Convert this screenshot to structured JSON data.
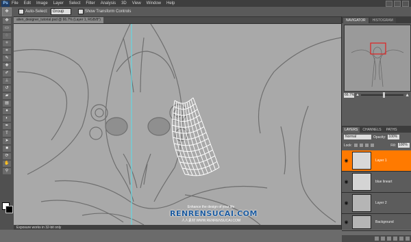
{
  "menubar": {
    "logo": "Ps",
    "items": [
      "File",
      "Edit",
      "Image",
      "Layer",
      "Select",
      "Filter",
      "Analysis",
      "3D",
      "View",
      "Window",
      "Help"
    ]
  },
  "options_bar": {
    "auto_select_label": "Auto-Select:",
    "auto_select_value": "Group",
    "transform_label": "Show Transform Controls"
  },
  "document_tab": {
    "title": "alien_designer_tutorial.psd @ 66.7% (Layer 1, RGB/8*)"
  },
  "status_bar": {
    "text": "Exposure works in 32-bit only"
  },
  "navigator": {
    "tabs": [
      "NAVIGATOR",
      "HISTOGRAM"
    ],
    "zoom": "66.7%"
  },
  "layers_panel": {
    "tabs": [
      "LAYERS",
      "CHANNELS",
      "PATHS"
    ],
    "blend_mode": "Normal",
    "opacity_label": "Opacity:",
    "opacity": "100%",
    "lock_label": "Lock:",
    "fill_label": "Fill:",
    "fill": "100%",
    "layers": [
      {
        "name": "Layer 1",
        "active": true
      },
      {
        "name": "blue lineart",
        "active": false
      },
      {
        "name": "Layer 2",
        "active": false
      },
      {
        "name": "Background",
        "active": false
      }
    ]
  },
  "watermark": {
    "line1": "Enhance the design of your life",
    "line2": "RENRENSUCAI.COM",
    "line3": "人人素材  WWW.RENRENSUCAI.COM"
  },
  "colors": {
    "active_layer": "#ff7a00",
    "canvas_bg": "#a9a9a9",
    "guide_line": "#6fd0d8",
    "navigator_box": "#e02020"
  }
}
